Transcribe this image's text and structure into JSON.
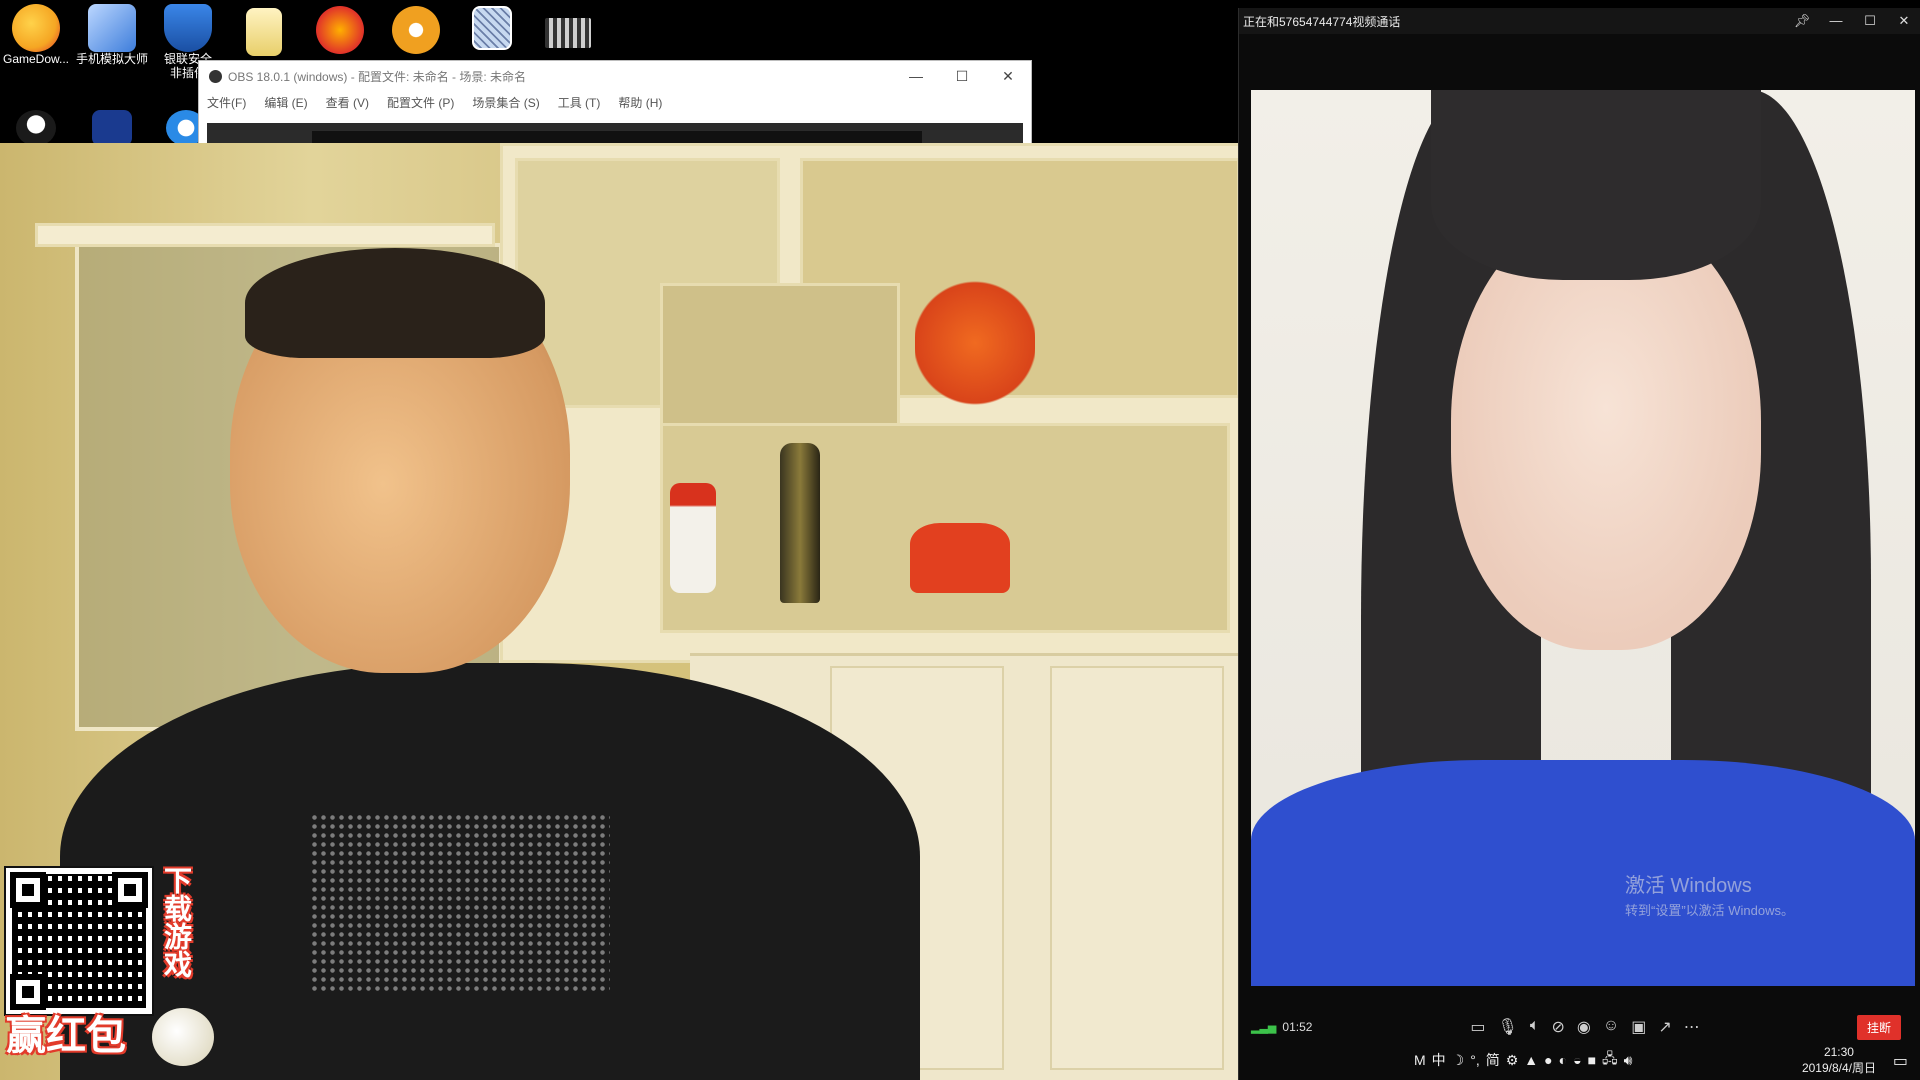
{
  "desktop": {
    "icons": [
      {
        "label": "GameDow...",
        "color": "#f5a623",
        "x_note": ""
      },
      {
        "label": "手机模拟大师",
        "color": "#3d7ddb"
      },
      {
        "label": "银联安全",
        "sublabel": "非插件",
        "color": "#2e6fd1"
      },
      {
        "label": "",
        "color": "#f3e4a3"
      },
      {
        "label": "",
        "color": "#e0312a"
      },
      {
        "label": "",
        "color": "#f0a020"
      },
      {
        "label": "",
        "color": "#c7d9f0"
      },
      {
        "label": "",
        "color": "#cfcfcf"
      }
    ]
  },
  "obs": {
    "title": "OBS 18.0.1 (windows) - 配置文件: 未命名 - 场景: 未命名",
    "menu": [
      "文件(F)",
      "编辑 (E)",
      "查看 (V)",
      "配置文件 (P)",
      "场景集合 (S)",
      "工具 (T)",
      "帮助 (H)"
    ]
  },
  "overlay": {
    "vertical_text": "下载游戏",
    "bottom_text": "赢红包"
  },
  "call": {
    "title": "正在和57654744774视频通话",
    "duration": "01:52",
    "hangup_label": "挂断",
    "watermark_line1": "激活 Windows",
    "watermark_line2": "转到“设置”以激活 Windows。"
  },
  "tray": {
    "ime_mode": "M",
    "ime_lang": "中",
    "ime_extra": "简",
    "time": "21:30",
    "date": "2019/8/4/周日"
  },
  "colors": {
    "hangup": "#e0312a",
    "signal": "#3cc24a"
  }
}
